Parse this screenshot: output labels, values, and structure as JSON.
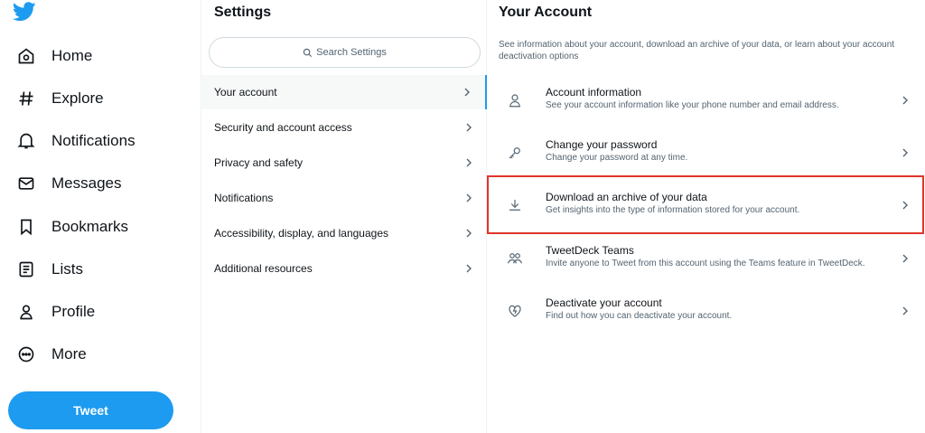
{
  "colors": {
    "accent": "#1d9bf0",
    "highlight": "#e0352b",
    "text": "#0f1419",
    "muted": "#536471"
  },
  "nav": {
    "logo_icon": "twitter-bird-icon",
    "items": [
      {
        "label": "Home",
        "icon": "home-icon"
      },
      {
        "label": "Explore",
        "icon": "hashtag-icon"
      },
      {
        "label": "Notifications",
        "icon": "bell-icon"
      },
      {
        "label": "Messages",
        "icon": "envelope-icon"
      },
      {
        "label": "Bookmarks",
        "icon": "bookmark-icon"
      },
      {
        "label": "Lists",
        "icon": "list-icon"
      },
      {
        "label": "Profile",
        "icon": "person-icon"
      },
      {
        "label": "More",
        "icon": "more-circle-icon"
      }
    ],
    "tweet_label": "Tweet"
  },
  "settings": {
    "title": "Settings",
    "search_placeholder": "Search Settings",
    "items": [
      {
        "label": "Your account",
        "active": true
      },
      {
        "label": "Security and account access"
      },
      {
        "label": "Privacy and safety"
      },
      {
        "label": "Notifications"
      },
      {
        "label": "Accessibility, display, and languages"
      },
      {
        "label": "Additional resources"
      }
    ]
  },
  "account": {
    "title": "Your Account",
    "description": "See information about your account, download an archive of your data, or learn about your account deactivation options",
    "items": [
      {
        "title": "Account information",
        "subtitle": "See your account information like your phone number and email address.",
        "icon": "person-icon"
      },
      {
        "title": "Change your password",
        "subtitle": "Change your password at any time.",
        "icon": "key-icon"
      },
      {
        "title": "Download an archive of your data",
        "subtitle": "Get insights into the type of information stored for your account.",
        "icon": "download-icon"
      },
      {
        "title": "TweetDeck Teams",
        "subtitle": "Invite anyone to Tweet from this account using the Teams feature in TweetDeck.",
        "icon": "people-icon"
      },
      {
        "title": "Deactivate your account",
        "subtitle": "Find out how you can deactivate your account.",
        "icon": "broken-heart-icon"
      }
    ]
  }
}
